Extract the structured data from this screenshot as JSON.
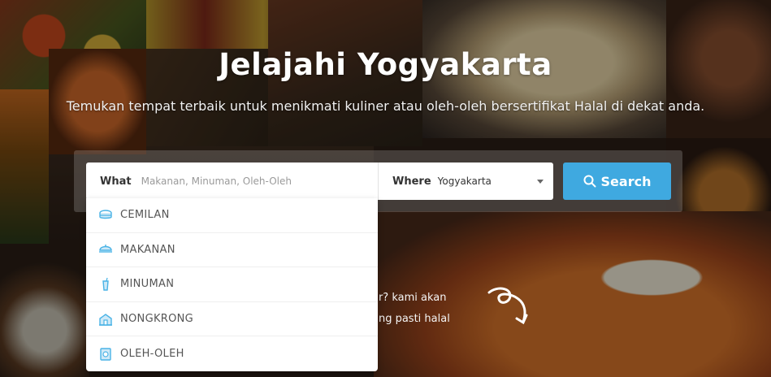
{
  "hero": {
    "title": "Jelajahi Yogyakarta",
    "subtitle": "Temukan tempat terbaik untuk menikmati kuliner atau oleh-oleh bersertifikat Halal di dekat anda."
  },
  "search": {
    "what_label": "What",
    "what_placeholder": "Makanan, Minuman, Oleh-Oleh",
    "where_label": "Where",
    "where_value": "Yogyakarta",
    "button_label": "Search"
  },
  "dropdown": {
    "items": [
      {
        "label": "CEMILAN",
        "icon": "snack-icon"
      },
      {
        "label": "MAKANAN",
        "icon": "food-icon"
      },
      {
        "label": "MINUMAN",
        "icon": "drink-icon"
      },
      {
        "label": "NONGKRONG",
        "icon": "hangout-icon"
      },
      {
        "label": "OLEH-OLEH",
        "icon": "souvenir-icon"
      }
    ]
  },
  "behind_text": {
    "line1": "ar? kami akan",
    "line2": "ang pasti halal"
  },
  "colors": {
    "accent": "#3fa9e0",
    "icon": "#4ab3e6"
  }
}
